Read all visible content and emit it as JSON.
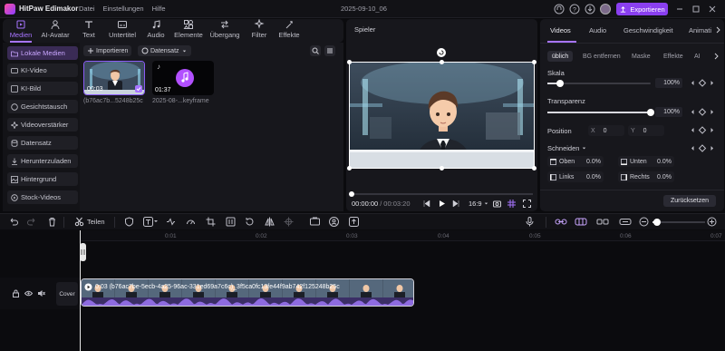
{
  "app": {
    "name": "HitPaw Edimakor",
    "doc_title": "2025-09-10_06",
    "export_label": "Exportieren"
  },
  "menu": [
    "Datei",
    "Einstellungen",
    "Hilfe"
  ],
  "toolbar": [
    {
      "label": "Medien",
      "icon": "media-icon",
      "active": true
    },
    {
      "label": "AI-Avatar",
      "icon": "ai-avatar-icon"
    },
    {
      "label": "Text",
      "icon": "text-icon"
    },
    {
      "label": "Untertitel",
      "icon": "subtitle-icon"
    },
    {
      "label": "Audio",
      "icon": "audio-icon"
    },
    {
      "label": "Elemente",
      "icon": "elements-icon"
    },
    {
      "label": "Übergang",
      "icon": "transition-icon"
    },
    {
      "label": "Filter",
      "icon": "filter-icon"
    },
    {
      "label": "Effekte",
      "icon": "effects-icon"
    }
  ],
  "sidebar": [
    {
      "label": "Lokale Medien",
      "active": true
    },
    {
      "label": "KI-Video"
    },
    {
      "label": "KI-Bild"
    },
    {
      "label": "Gesichtstausch"
    },
    {
      "label": "Videoverstärker"
    },
    {
      "label": "Datensatz"
    },
    {
      "label": "Herunterzuladen"
    },
    {
      "label": "Hintergrund"
    },
    {
      "label": "Stock-Videos"
    }
  ],
  "media": {
    "import_label": "Importieren",
    "dataset_label": "Datensatz",
    "items": [
      {
        "duration": "00:03",
        "name": "(b76ac7b...5248b25c"
      },
      {
        "duration": "01:37",
        "name": "2025-08-...keyframe"
      }
    ]
  },
  "player": {
    "title": "Spieler",
    "current_time": "00:00:00",
    "separator": "/",
    "total_time": "00:03:20",
    "ratio": "16:9"
  },
  "properties": {
    "tabs": [
      "Videos",
      "Audio",
      "Geschwindigkeit",
      "Animati"
    ],
    "subtabs": [
      "üblich",
      "BG entfernen",
      "Maske",
      "Effekte",
      "AI"
    ],
    "scale_label": "Skala",
    "scale_value": "100%",
    "scale_level": 0.12,
    "transparency_label": "Transparenz",
    "transparency_value": "100%",
    "transparency_level": 1.0,
    "position_label": "Position",
    "pos_x_label": "X",
    "pos_x": "0",
    "pos_y_label": "Y",
    "pos_y": "0",
    "crop_label": "Schneiden",
    "crop": [
      {
        "label": "Oben",
        "value": "0.0%"
      },
      {
        "label": "Unten",
        "value": "0.0%"
      },
      {
        "label": "Links",
        "value": "0.0%"
      },
      {
        "label": "Rechts",
        "value": "0.0%"
      }
    ],
    "reset_label": "Zurücksetzen"
  },
  "timeline": {
    "split_label": "Teilen",
    "ruler": [
      "0:01",
      "0:02",
      "0:03",
      "0:04",
      "0:05",
      "0:06",
      "0:07"
    ],
    "cover_label": "Cover",
    "clip_label": "0:03 (b76ac7be-5ecb-4a25-96ac-331ed69a7c6c)_3f5ca0fc13fe44f9ab742f125248b25c"
  },
  "colors": {
    "accent": "#a774ff",
    "export": "#8a3ff0",
    "panel": "#17171c",
    "background": "#0b0b0e"
  }
}
